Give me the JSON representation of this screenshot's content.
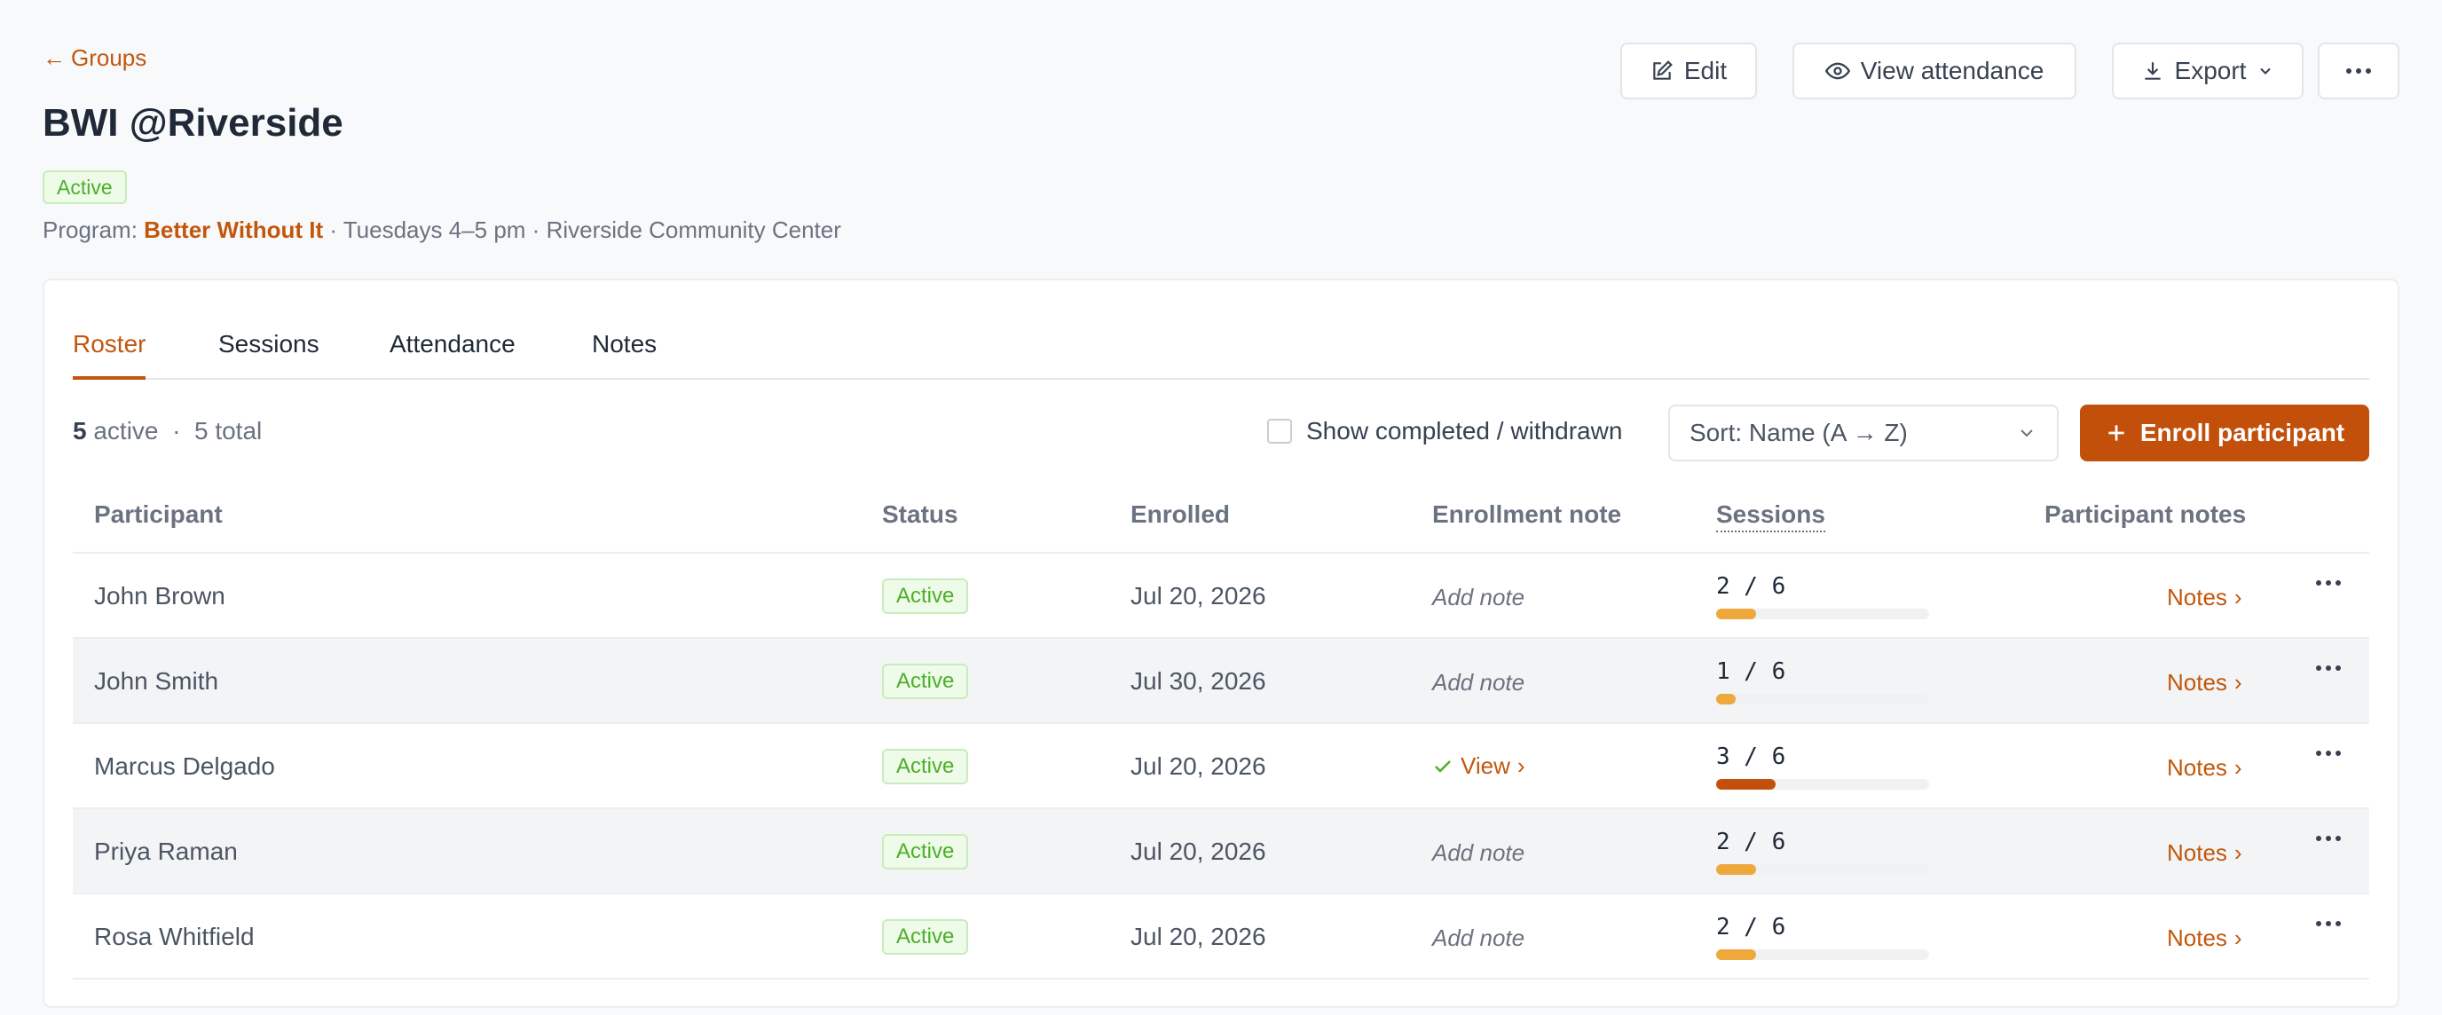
{
  "header": {
    "back_label": "Groups",
    "back_arrow": "←",
    "title": "BWI @Riverside",
    "status": "Active",
    "program_prefix": "Program: ",
    "program_name": "Better Without It",
    "schedule": " · Tuesdays 4–5 pm · Riverside Community Center"
  },
  "actions": {
    "edit": "Edit",
    "view_attendance": "View attendance",
    "export": "Export"
  },
  "tabs": [
    {
      "label": "Roster",
      "active": true
    },
    {
      "label": "Sessions",
      "active": false
    },
    {
      "label": "Attendance",
      "active": false
    },
    {
      "label": "Notes",
      "active": false
    }
  ],
  "summary": {
    "active_count": "5",
    "active_label": " active",
    "separator": "  ·  ",
    "total": "5 total"
  },
  "filters": {
    "show_completed_label": "Show completed / withdrawn",
    "show_completed_checked": false,
    "sort_label": "Sort: Name (A → Z)",
    "enroll_label": "Enroll participant"
  },
  "table": {
    "columns": {
      "participant": "Participant",
      "status": "Status",
      "enrolled": "Enrolled",
      "enrollment_note": "Enrollment note",
      "sessions": "Sessions",
      "participant_notes": "Participant notes"
    },
    "rows": [
      {
        "name": "John Brown",
        "status": "Active",
        "enrolled": "Jul 20, 2026",
        "note": "Add note",
        "note_view": false,
        "sessions": "2 / 6",
        "attended": 2,
        "total": 6,
        "bar_color": "#efa83c",
        "notes_label": "Notes"
      },
      {
        "name": "John Smith",
        "status": "Active",
        "enrolled": "Jul 30, 2026",
        "note": "Add note",
        "note_view": false,
        "sessions": "1 / 6",
        "attended": 1,
        "total": 6,
        "bar_color": "#efa83c",
        "notes_label": "Notes"
      },
      {
        "name": "Marcus Delgado",
        "status": "Active",
        "enrolled": "Jul 20, 2026",
        "note": "View",
        "note_view": true,
        "sessions": "3 / 6",
        "attended": 3,
        "total": 6,
        "bar_color": "#c2500b",
        "notes_label": "Notes"
      },
      {
        "name": "Priya Raman",
        "status": "Active",
        "enrolled": "Jul 20, 2026",
        "note": "Add note",
        "note_view": false,
        "sessions": "2 / 6",
        "attended": 2,
        "total": 6,
        "bar_color": "#efa83c",
        "notes_label": "Notes"
      },
      {
        "name": "Rosa Whitfield",
        "status": "Active",
        "enrolled": "Jul 20, 2026",
        "note": "Add note",
        "note_view": false,
        "sessions": "2 / 6",
        "attended": 2,
        "total": 6,
        "bar_color": "#efa83c",
        "notes_label": "Notes"
      }
    ]
  },
  "colors": {
    "accent": "#c2570c",
    "primary_button": "#c2500b",
    "success_text": "#4caf2a"
  }
}
